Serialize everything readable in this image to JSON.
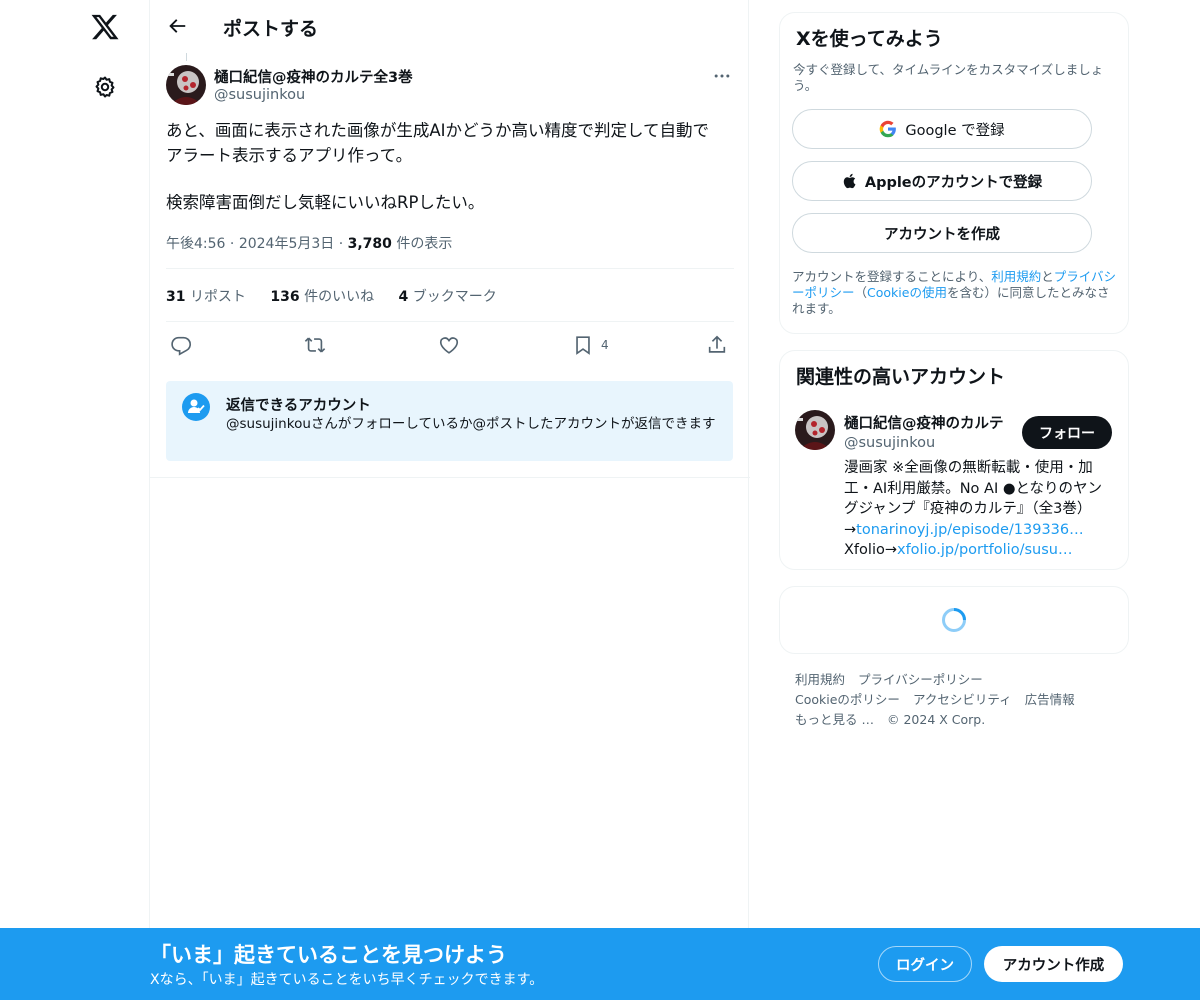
{
  "nav": {
    "logo_icon": "x-logo-icon",
    "settings_icon": "gear-icon"
  },
  "header": {
    "title": "ポストする"
  },
  "post": {
    "author_name": "樋口紀信@疫神のカルテ全3巻",
    "author_handle": "@susujinkou",
    "text_lines": [
      "あと、画面に表示された画像が生成AIかどうか高い精度で判定して自動で",
      "アラート表示するアプリ作って。",
      "検索障害面倒だし気軽にいいねRPしたい。"
    ],
    "time": "午後4:56",
    "date": "2024年5月3日",
    "views_count": "3,780",
    "views_label": "件の表示",
    "stats": {
      "reposts_count": "31",
      "reposts_label": "リポスト",
      "likes_count": "136",
      "likes_label": "件のいいね",
      "bookmarks_count": "4",
      "bookmarks_label": "ブックマーク"
    },
    "bookmark_action_count": "4"
  },
  "reply_restriction": {
    "title": "返信できるアカウント",
    "text": "@susujinkouさんがフォローしているか@ポストしたアカウントが返信できます"
  },
  "signup_card": {
    "title": "Xを使ってみよう",
    "subtitle": "今すぐ登録して、タイムラインをカスタマイズしましょう。",
    "google_button": "Google で登録",
    "apple_button": "Appleのアカウントで登録",
    "create_button": "アカウントを作成",
    "terms_prefix": "アカウントを登録することにより、",
    "terms_link": "利用規約",
    "terms_and": "と",
    "privacy_link": "プライバシーポリシー",
    "terms_mid": "（",
    "cookie_link": "Cookieの使用",
    "terms_suffix": "を含む）に同意したとみなされます。"
  },
  "related_card": {
    "title": "関連性の高いアカウント",
    "account_name": "樋口紀信@疫神のカルテ",
    "account_handle": "@susujinkou",
    "follow_button": "フォロー",
    "bio_line1": "漫画家 ※全画像の無断転載・使用・加",
    "bio_line2": "工・AI利用厳禁。No AI ●となりのヤン",
    "bio_line3": "グジャンプ『疫神のカルテ』（全3巻）",
    "bio_arrow": "→",
    "bio_link1": "tonarinoyj.jp/episode/139336…",
    "bio_xfolio": "Xfolio→",
    "bio_link2": "xfolio.jp/portfolio/susu…"
  },
  "footer": {
    "terms": "利用規約",
    "privacy": "プライバシーポリシー",
    "cookie": "Cookieのポリシー",
    "accessibility": "アクセシビリティ",
    "ads": "広告情報",
    "more": "もっと見る …",
    "copyright": "© 2024 X Corp."
  },
  "banner": {
    "title": "「いま」起きていることを見つけよう",
    "subtitle": "Xなら、「いま」起きていることをいち早くチェックできます。",
    "login_button": "ログイン",
    "create_button": "アカウント作成"
  },
  "colors": {
    "accent": "#1d9bf0",
    "text": "#0f1419",
    "secondary": "#536471",
    "border": "#eff3f4"
  }
}
